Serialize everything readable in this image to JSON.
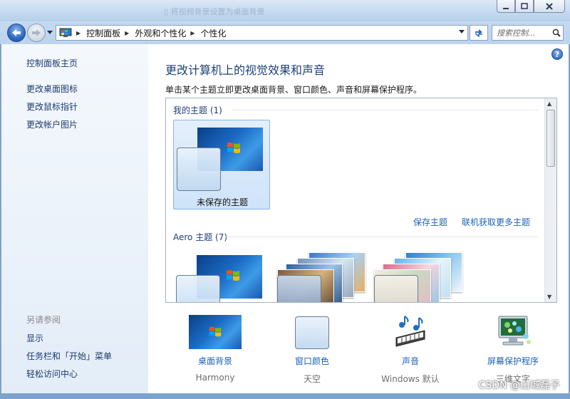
{
  "window": {
    "ghost_title": "▯ 将视频背景设置为桌面背景",
    "minimize_label": "minimize",
    "maximize_label": "maximize",
    "close_label": "close"
  },
  "address": {
    "crumbs": [
      "控制面板",
      "外观和个性化",
      "个性化"
    ]
  },
  "search": {
    "placeholder": "搜索控制..."
  },
  "sidebar": {
    "home": "控制面板主页",
    "links": [
      "更改桌面图标",
      "更改鼠标指针",
      "更改帐户图片"
    ],
    "see_also_title": "另请参阅",
    "see_also": [
      "显示",
      "任务栏和「开始」菜单",
      "轻松访问中心"
    ]
  },
  "main": {
    "title": "更改计算机上的视觉效果和声音",
    "description": "单击某个主题立即更改桌面背景、窗口颜色、声音和屏幕保护程序。",
    "my_themes_label": "我的主题 (1)",
    "unsaved_theme": "未保存的主题",
    "save_theme": "保存主题",
    "get_more_themes": "联机获取更多主题",
    "aero_label": "Aero 主题 (7)"
  },
  "bottom": [
    {
      "label": "桌面背景",
      "value": "Harmony",
      "icon": "wallpaper-icon"
    },
    {
      "label": "窗口颜色",
      "value": "天空",
      "icon": "window-color-icon"
    },
    {
      "label": "声音",
      "value": "Windows 默认",
      "icon": "sound-icon"
    },
    {
      "label": "屏幕保护程序",
      "value": "三维文字",
      "icon": "screensaver-icon"
    }
  ],
  "watermark": "CSDN @山城磊子",
  "colors": {
    "link": "#1d62b8",
    "title": "#1e3f7a",
    "accent_blue": "#1b6cc6"
  }
}
